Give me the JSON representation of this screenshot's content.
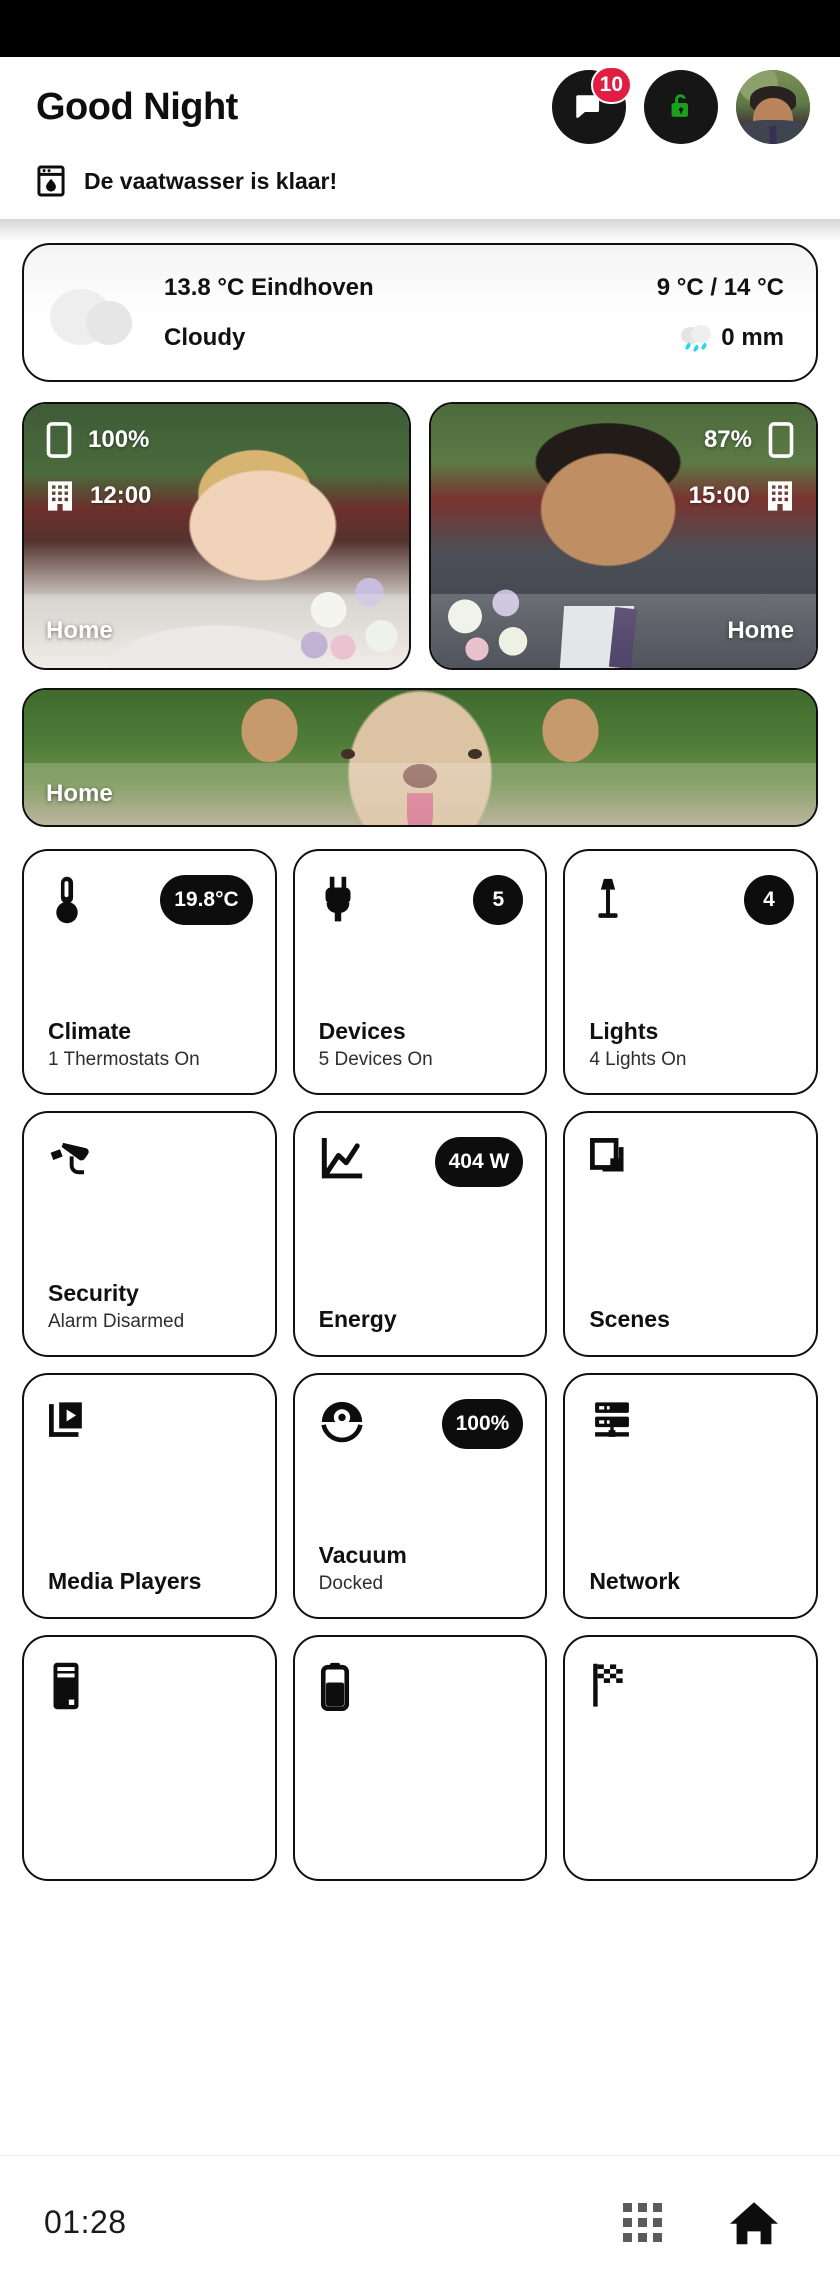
{
  "header": {
    "greeting": "Good Night",
    "messages_badge": "10",
    "messages_icon": "chat-bubble-icon",
    "lock_icon": "unlocked-padlock-icon",
    "lock_color": "#1aa01a",
    "badge_color": "#e01e43",
    "avatar_label": "user-avatar"
  },
  "notification": {
    "icon": "dishwasher-icon",
    "text": "De vaatwasser is klaar!"
  },
  "weather": {
    "icon": "cloudy-icon",
    "temperature_location": "13.8 °C Eindhoven",
    "high_low": "9 °C / 14 °C",
    "condition": "Cloudy",
    "precipitation_icon": "rain-cloud-icon",
    "precipitation": "0 mm"
  },
  "people": [
    {
      "name": "Home",
      "battery_icon": "phone-icon",
      "battery": "100%",
      "place_icon": "office-building-icon",
      "time": "12:00",
      "align": "left",
      "photo": "bride-photo"
    },
    {
      "name": "Home",
      "battery_icon": "phone-icon",
      "battery": "87%",
      "place_icon": "office-building-icon",
      "time": "15:00",
      "align": "right",
      "photo": "groom-photo"
    }
  ],
  "wide_card": {
    "name": "Home",
    "photo": "dog-photo"
  },
  "tiles": [
    {
      "icon": "thermometer-icon",
      "badge": "19.8°C",
      "badge_shape": "pill",
      "title": "Climate",
      "subtitle": "1 Thermostats On"
    },
    {
      "icon": "power-plug-icon",
      "badge": "5",
      "badge_shape": "round",
      "title": "Devices",
      "subtitle": "5 Devices On"
    },
    {
      "icon": "floor-lamp-icon",
      "badge": "4",
      "badge_shape": "round",
      "title": "Lights",
      "subtitle": "4 Lights On"
    },
    {
      "icon": "cctv-camera-icon",
      "badge": "",
      "badge_shape": "none",
      "title": "Security",
      "subtitle": "Alarm Disarmed"
    },
    {
      "icon": "line-chart-icon",
      "badge": "404 W",
      "badge_shape": "pill",
      "title": "Energy",
      "subtitle": ""
    },
    {
      "icon": "layers-icon",
      "badge": "",
      "badge_shape": "none",
      "title": "Scenes",
      "subtitle": ""
    },
    {
      "icon": "media-player-icon",
      "badge": "",
      "badge_shape": "none",
      "title": "Media Players",
      "subtitle": ""
    },
    {
      "icon": "robot-vacuum-icon",
      "badge": "100%",
      "badge_shape": "pill",
      "title": "Vacuum",
      "subtitle": "Docked"
    },
    {
      "icon": "server-rack-icon",
      "badge": "",
      "badge_shape": "none",
      "title": "Network",
      "subtitle": ""
    },
    {
      "icon": "server-tower-icon",
      "badge": "",
      "badge_shape": "none",
      "title": "",
      "subtitle": ""
    },
    {
      "icon": "battery-icon",
      "badge": "",
      "badge_shape": "none",
      "title": "",
      "subtitle": ""
    },
    {
      "icon": "checkered-flag-icon",
      "badge": "",
      "badge_shape": "none",
      "title": "",
      "subtitle": ""
    }
  ],
  "bottom_bar": {
    "clock": "01:28",
    "apps_icon": "grid-apps-icon",
    "home_icon": "home-icon"
  }
}
